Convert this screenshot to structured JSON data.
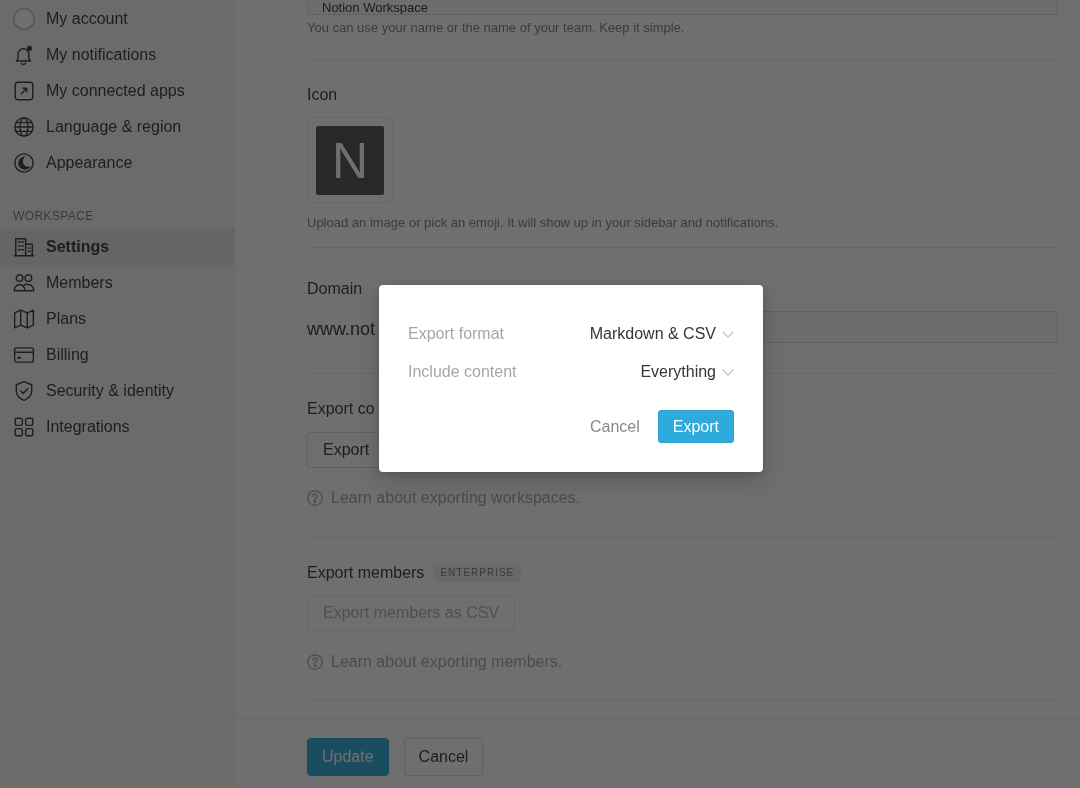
{
  "sidebar": {
    "sections": [
      {
        "items": [
          {
            "label": "My account",
            "selected": false
          },
          {
            "label": "My notifications",
            "selected": false
          },
          {
            "label": "My connected apps",
            "selected": false
          },
          {
            "label": "Language & region",
            "selected": false
          },
          {
            "label": "Appearance",
            "selected": false
          }
        ]
      },
      {
        "title": "WORKSPACE",
        "items": [
          {
            "label": "Settings",
            "selected": true
          },
          {
            "label": "Members",
            "selected": false
          },
          {
            "label": "Plans",
            "selected": false
          },
          {
            "label": "Billing",
            "selected": false
          },
          {
            "label": "Security & identity",
            "selected": false
          },
          {
            "label": "Integrations",
            "selected": false
          }
        ]
      }
    ]
  },
  "settings": {
    "name": {
      "value": "Notion Workspace",
      "hint": "You can use your name or the name of your team. Keep it simple."
    },
    "icon": {
      "label": "Icon",
      "initial": "N",
      "hint": "Upload an image or pick an emoji. It will show up in your sidebar and notifications."
    },
    "domain": {
      "label": "Domain",
      "prefix": "www.not"
    },
    "export_content": {
      "heading": "Export co",
      "button": "Export"
    },
    "export_content_help": "Learn about exporting workspaces.",
    "export_members": {
      "heading": "Export members",
      "badge": "ENTERPRISE",
      "button": "Export members as CSV",
      "disabled": true,
      "help": "Learn about exporting members."
    }
  },
  "footer": {
    "buttons": [
      {
        "label": "Update",
        "kind": "primary"
      },
      {
        "label": "Cancel",
        "kind": "secondary"
      }
    ]
  },
  "dialog": {
    "rows": [
      {
        "label": "Export format",
        "value": "Markdown & CSV"
      },
      {
        "label": "Include content",
        "value": "Everything"
      }
    ],
    "buttons": [
      {
        "label": "Cancel",
        "kind": "text"
      },
      {
        "label": "Export",
        "kind": "primary"
      }
    ]
  }
}
